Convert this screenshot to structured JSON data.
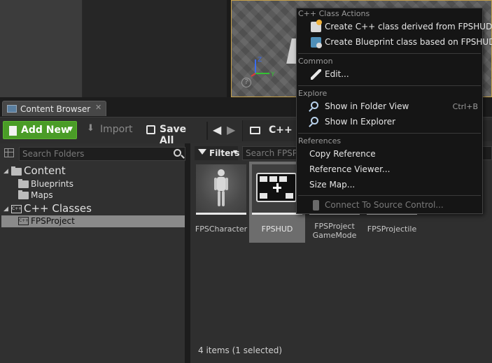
{
  "content_browser_tab": {
    "label": "Content Browser",
    "close": "✕"
  },
  "toolbar": {
    "add_new_label": "Add New",
    "import_label": "Import",
    "save_all_label": "Save All",
    "back_glyph": "🡰",
    "forward_glyph": "🡲",
    "path_label": "C++ C"
  },
  "folder_tree": {
    "search_placeholder": "Search Folders",
    "items": [
      {
        "label": "Content",
        "icon": "folder-icon",
        "expanded": true
      },
      {
        "label": "Blueprints",
        "icon": "folder-icon"
      },
      {
        "label": "Maps",
        "icon": "folder-icon"
      },
      {
        "label": "C++ Classes",
        "icon": "cpp-classes-icon",
        "expanded": true
      },
      {
        "label": "FPSProject",
        "icon": "cpp-folder-icon",
        "selected": true
      }
    ]
  },
  "asset_view": {
    "filters_label": "Filters",
    "search_placeholder": "Search FPSP",
    "tiles": [
      {
        "name": "FPSCharacter"
      },
      {
        "name": "FPSHUD",
        "selected": true
      },
      {
        "name_line1": "FPSProject",
        "name_line2": "GameMode"
      },
      {
        "name": "FPSProjectile"
      }
    ],
    "item_count": "4 items (1 selected)"
  },
  "context_menu": {
    "sections": [
      {
        "heading": "C++ Class Actions",
        "items": [
          {
            "label": "Create C++ class derived from FPSHUD",
            "icon": "cpp-class-icon"
          },
          {
            "label": "Create Blueprint class based on FPSHUD",
            "icon": "blueprint-class-icon"
          }
        ]
      },
      {
        "heading": "Common",
        "items": [
          {
            "label": "Edit...",
            "icon": "edit-icon"
          }
        ]
      },
      {
        "heading": "Explore",
        "items": [
          {
            "label": "Show in Folder View",
            "icon": "search-icon",
            "shortcut": "Ctrl+B"
          },
          {
            "label": "Show In Explorer",
            "icon": "search-icon"
          }
        ]
      },
      {
        "heading": "References",
        "items": [
          {
            "label": "Copy Reference"
          },
          {
            "label": "Reference Viewer..."
          },
          {
            "label": "Size Map..."
          }
        ]
      }
    ],
    "footer_item": {
      "label": "Connect To Source Control...",
      "icon": "plug-icon",
      "disabled": true
    }
  },
  "viewport": {
    "help": "?",
    "axis_x": "Y",
    "axis_z": "Z"
  },
  "colors": {
    "add_new_green": "#4a9c27",
    "selection_gray": "#8a8a8a",
    "viewport_border": "#c8a24a",
    "menu_bg": "#151515"
  }
}
